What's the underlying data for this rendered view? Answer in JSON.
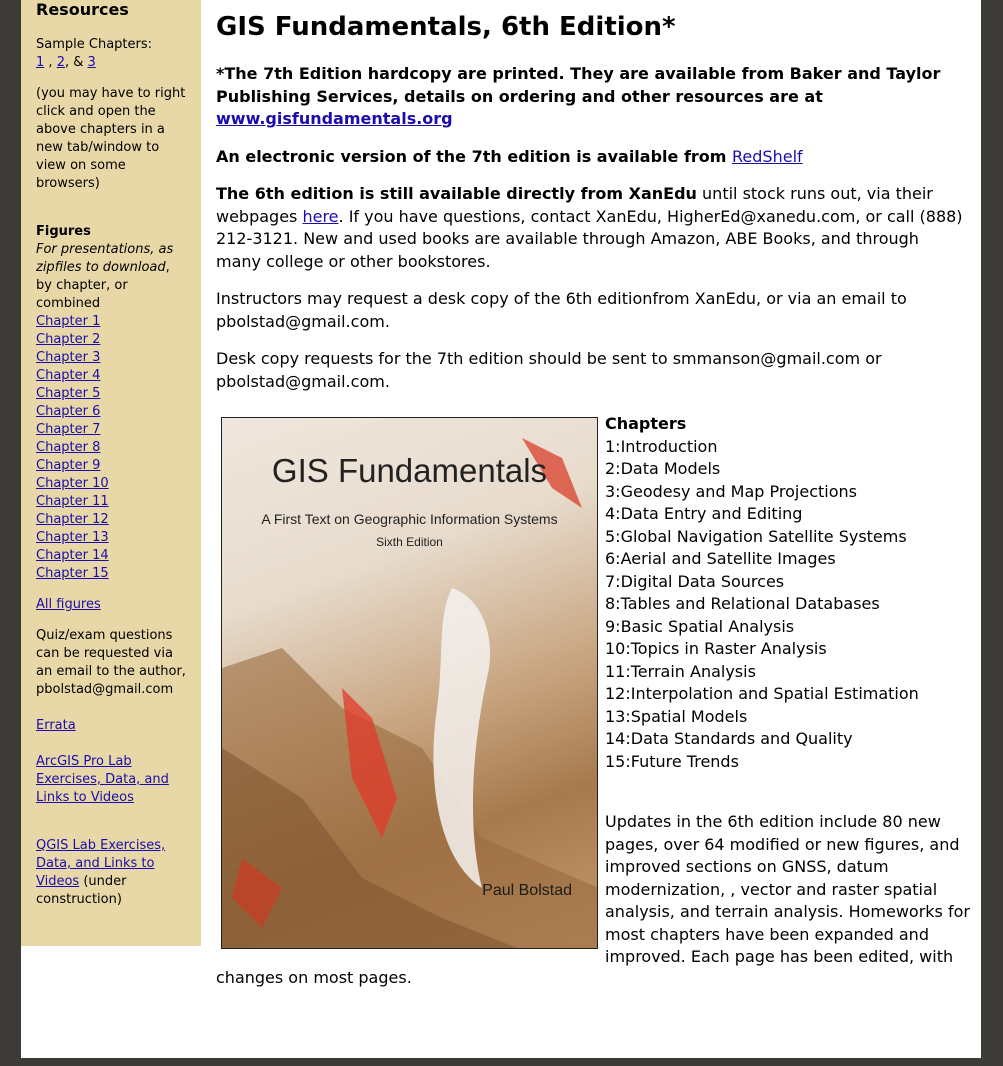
{
  "sidebar": {
    "heading": "Resources",
    "sample_label": "Sample Chapters:",
    "sample_links": [
      "1",
      "2",
      "3"
    ],
    "sample_sep1": " , ",
    "sample_sep2": ", & ",
    "sample_note": "(you may have to right click and open the above chapters in a new tab/window to view on some browsers)",
    "figures_heading": "Figures",
    "figures_note_italic": "For presentations, as zipfiles to download",
    "figures_note_rest": ", by chapter, or combined",
    "chapter_links": [
      "Chapter 1",
      "Chapter 2",
      "Chapter 3",
      "Chapter 4",
      "Chapter 5",
      "Chapter 6",
      "Chapter 7",
      "Chapter 8",
      "Chapter 9",
      "Chapter 10",
      "Chapter 11",
      "Chapter 12",
      "Chapter 13",
      "Chapter 14",
      "Chapter 15"
    ],
    "all_figures": "All figures",
    "quiz_note": "Quiz/exam questions can be requested via an email to the author, pbolstad@gmail.com",
    "errata": "Errata",
    "arcgis_link": "ArcGIS Pro Lab Exercises, Data, and Links to Videos",
    "qgis_link": "QGIS Lab Exercises, Data, and Links to Videos",
    "qgis_suffix": " (under construction)"
  },
  "main": {
    "title": "GIS Fundamentals, 6th Edition*",
    "p1_bold": "*The 7th Edition hardcopy are printed. They are available from Baker and Taylor Publishing Services, details on ordering and other resources are at ",
    "p1_link": "www.gisfundamentals.org",
    "p2_bold": "An electronic version of the 7th edition is available from ",
    "p2_link": "RedShelf",
    "p3_bold": "The 6th edition is still available directly from XanEdu",
    "p3_rest1": " until stock runs out, via their webpages ",
    "p3_link": "here",
    "p3_rest2": ". If you have questions, contact XanEdu, HigherEd@xanedu.com, or call (888) 212-3121. New and used books are available through Amazon, ABE Books, and through many college or other bookstores.",
    "p4": "Instructors may request a desk copy of the 6th editionfrom XanEdu, or via an email to pbolstad@gmail.com.",
    "p5": "Desk copy requests for the 7th edition should be sent to smmanson@gmail.com or pbolstad@gmail.com.",
    "cover": {
      "title": "GIS Fundamentals",
      "subtitle": "A First Text on Geographic Information Systems",
      "edition": "Sixth Edition",
      "author": "Paul Bolstad"
    },
    "chapters_heading": "Chapters",
    "chapters": [
      "1:Introduction",
      "2:Data Models",
      "3:Geodesy and Map Projections",
      "4:Data Entry and Editing",
      "5:Global Navigation Satellite Systems",
      "6:Aerial and Satellite Images",
      "7:Digital Data Sources",
      "8:Tables and Relational Databases",
      "9:Basic Spatial Analysis",
      "10:Topics in Raster Analysis",
      "11:Terrain Analysis",
      "12:Interpolation and Spatial Estimation",
      "13:Spatial Models",
      "14:Data Standards and Quality",
      "15:Future Trends"
    ],
    "updates": "Updates in the 6th edition include 80 new pages, over 64 modified or new figures, and improved sections on GNSS, datum modernization, , vector and raster spatial analysis, and terrain analysis. Homeworks for most chapters have been expanded and improved. Each page has been edited, with",
    "updates_tail": "changes on most pages."
  }
}
